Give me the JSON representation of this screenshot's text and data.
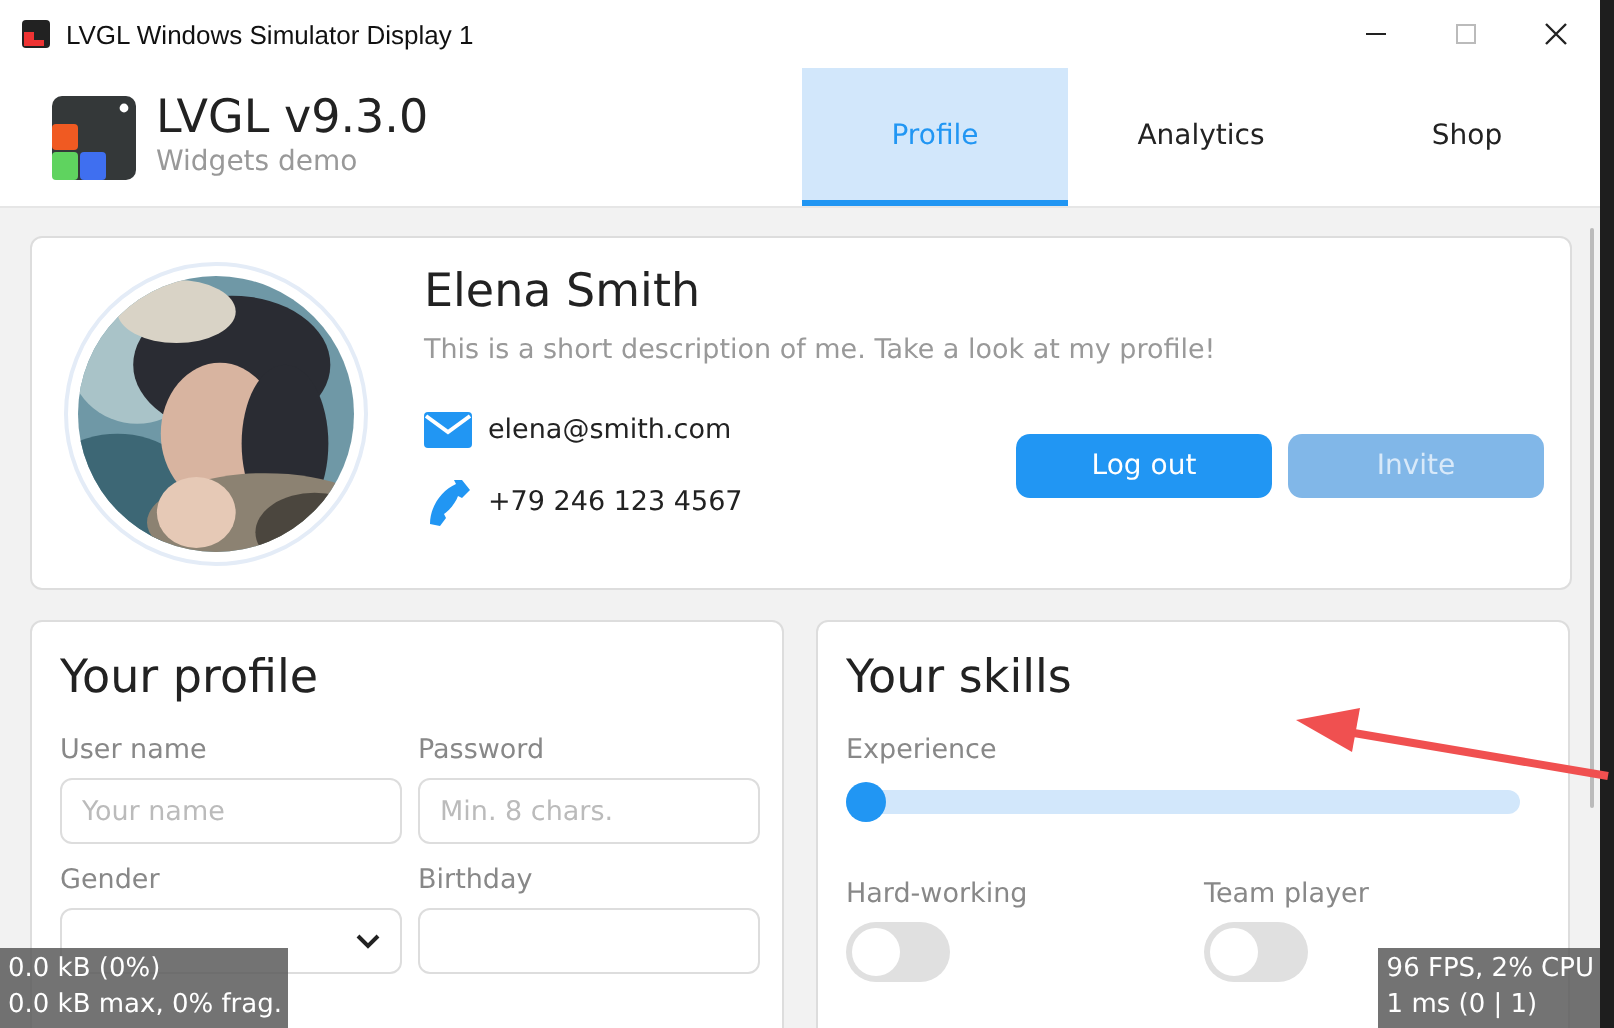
{
  "window": {
    "title": "LVGL Windows Simulator Display 1"
  },
  "header": {
    "title": "LVGL v9.3.0",
    "subtitle": "Widgets demo"
  },
  "tabs": [
    {
      "label": "Profile",
      "selected": true
    },
    {
      "label": "Analytics",
      "selected": false
    },
    {
      "label": "Shop",
      "selected": false
    }
  ],
  "profile": {
    "name": "Elena Smith",
    "description": "This is a short description of me. Take a look at my profile!",
    "email": "elena@smith.com",
    "phone": "+79 246 123 4567",
    "buttons": [
      {
        "label": "Log out",
        "disabled": false
      },
      {
        "label": "Invite",
        "disabled": true
      }
    ]
  },
  "your_profile": {
    "title": "Your profile",
    "fields": [
      {
        "label": "User name",
        "placeholder": "Your name",
        "kind": "text"
      },
      {
        "label": "Password",
        "placeholder": "Min. 8 chars.",
        "kind": "text"
      },
      {
        "label": "Gender",
        "kind": "dropdown"
      },
      {
        "label": "Birthday",
        "kind": "text"
      }
    ]
  },
  "your_skills": {
    "title": "Your skills",
    "experience": {
      "label": "Experience",
      "level": 0
    },
    "toggles": [
      {
        "label": "Hard-working",
        "on": false
      },
      {
        "label": "Team player",
        "on": false
      }
    ]
  },
  "monitors": {
    "memory": [
      "0.0 kB (0%)",
      "0.0 kB max, 0% frag."
    ],
    "performance": [
      "96 FPS, 2% CPU",
      "1 ms (0 | 1)"
    ]
  }
}
